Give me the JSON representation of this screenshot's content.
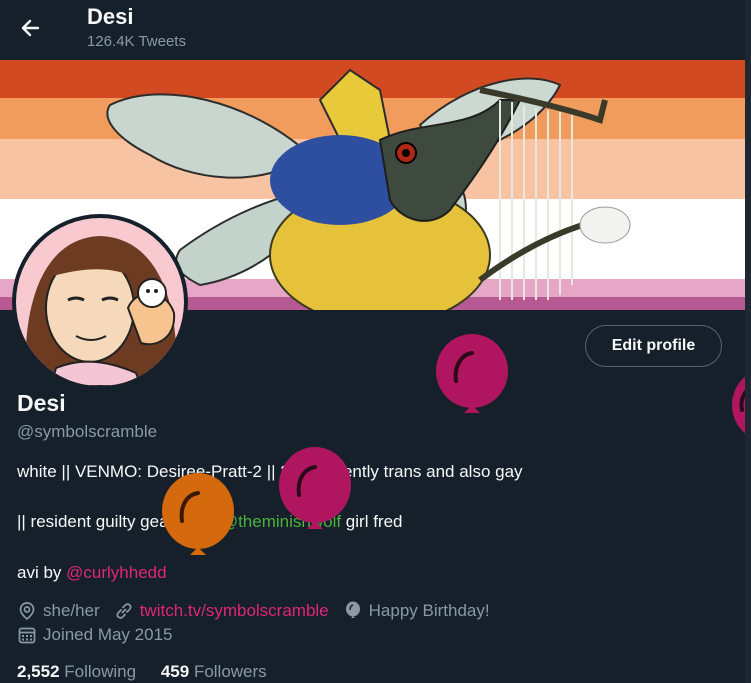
{
  "header": {
    "title": "Desi",
    "tweet_count": "126.4K Tweets"
  },
  "profile": {
    "display_name": "Desi",
    "handle": "@symbolscramble",
    "edit_button": "Edit profile",
    "bio": {
      "line1": "white || VENMO: Desiree-Pratt-2 || 20 || violently trans and also gay",
      "line2_pre": "|| resident guilty gear fan || ",
      "line2_mention": "@theminishwolf",
      "line2_post": " girl fred",
      "line3_pre": "avi by ",
      "line3_mention": "@curlyhhedd"
    },
    "pronouns": "she/her",
    "website": "twitch.tv/symbolscramble",
    "birthday": "Happy Birthday!",
    "joined": "Joined May 2015",
    "following_count": "2,552",
    "following_label": "Following",
    "followers_count": "459",
    "followers_label": "Followers"
  },
  "colors": {
    "background": "#15202b",
    "mention_pink": "#e0267a",
    "mention_green": "#4cb23a",
    "balloon_magenta": "#b0165f",
    "balloon_orange": "#d4690e"
  },
  "icons": [
    "back-arrow-icon",
    "location-icon",
    "link-icon",
    "balloon-icon",
    "calendar-icon"
  ]
}
